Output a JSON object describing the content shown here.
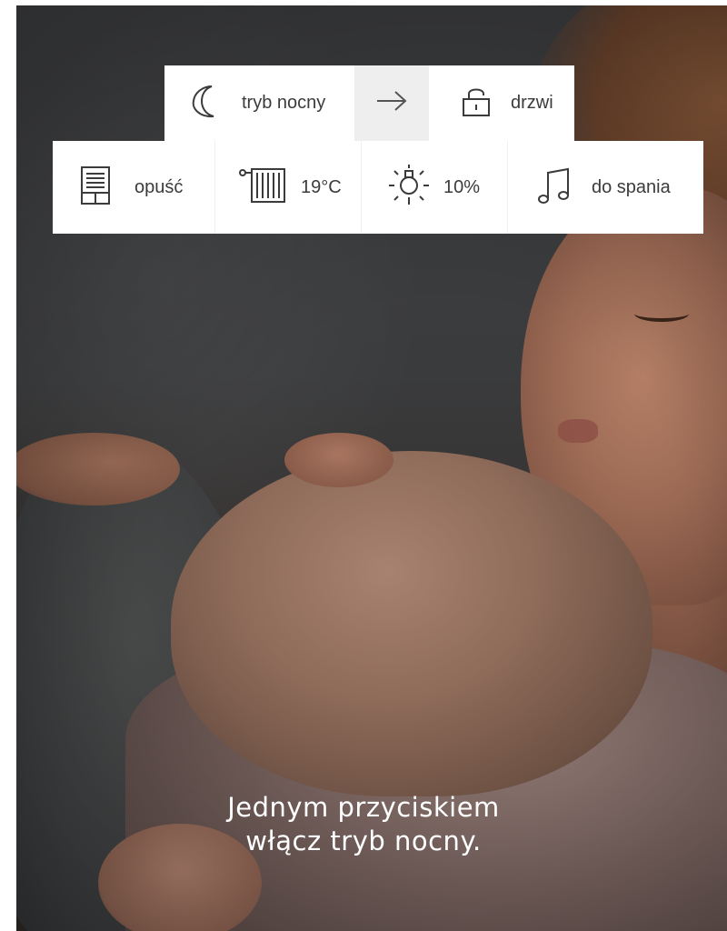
{
  "scene": {
    "top_bar": {
      "items": [
        {
          "icon": "moon-icon",
          "label": "tryb nocny"
        },
        {
          "icon": "arrow-right-icon"
        },
        {
          "icon": "padlock-icon",
          "label": "drzwi"
        }
      ]
    },
    "actions": [
      {
        "icon": "blinds-icon",
        "label": "opuść"
      },
      {
        "icon": "radiator-icon",
        "label": "19°C"
      },
      {
        "icon": "lightbulb-icon",
        "label": "10%"
      },
      {
        "icon": "music-note-icon",
        "label": "do spania"
      }
    ]
  },
  "caption": {
    "line1": "Jednym przyciskiem",
    "line2": "włącz tryb nocny."
  },
  "colors": {
    "panel_bg": "#ffffff",
    "arrow_bg": "#eeeeee",
    "text": "#3b3b3b",
    "caption": "#ffffff"
  }
}
